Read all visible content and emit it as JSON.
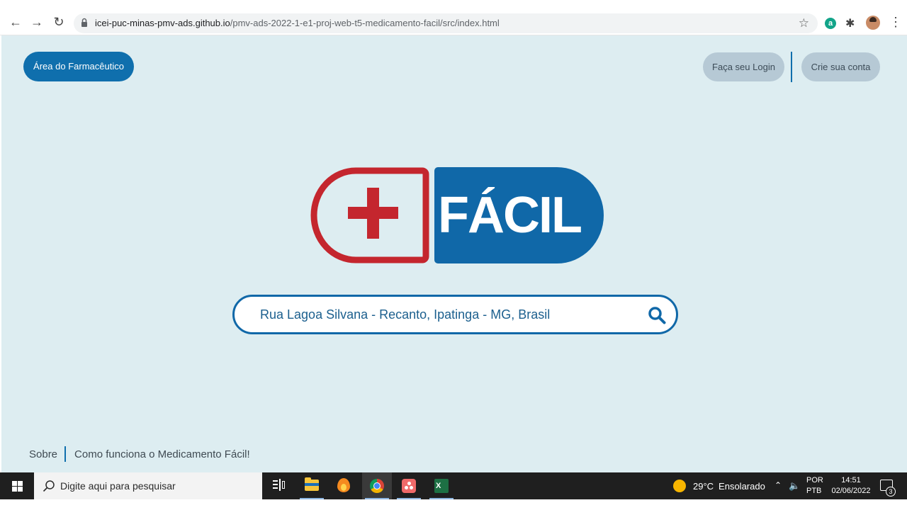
{
  "browser": {
    "url_host": "icei-puc-minas-pmv-ads.github.io",
    "url_path": "/pmv-ads-2022-1-e1-proj-web-t5-medicamento-facil/src/index.html",
    "icons": [
      "back-icon",
      "forward-icon",
      "reload-icon",
      "lock-icon",
      "star-icon",
      "extension-icon",
      "puzzle-icon",
      "avatar",
      "menu-icon"
    ],
    "extension_letter": "a"
  },
  "header": {
    "pharmacist_area_label": "Área do Farmacêutico",
    "login_label": "Faça seu Login",
    "signup_label": "Crie sua conta"
  },
  "logo": {
    "word": "FÁCIL",
    "colors": {
      "red": "#c4262e",
      "blue": "#1068a8"
    }
  },
  "search": {
    "value": "Rua Lagoa Silvana - Recanto, Ipatinga - MG, Brasil",
    "icon": "search-icon"
  },
  "footer": {
    "about_label": "Sobre",
    "how_it_works_label": "Como funciona o Medicamento Fácil!"
  },
  "taskbar": {
    "search_placeholder": "Digite aqui para pesquisar",
    "apps": [
      "task-view",
      "file-explorer",
      "flame-app",
      "chrome",
      "asana",
      "excel"
    ],
    "weather_temp": "29°C",
    "weather_text": "Ensolarado",
    "language_top": "POR",
    "language_bottom": "PTB",
    "time": "14:51",
    "date": "02/06/2022",
    "notification_count": "3"
  },
  "colors": {
    "page_background": "#ddedf1",
    "primary": "#0f6fad",
    "secondary_button": "#b6c9d5"
  }
}
